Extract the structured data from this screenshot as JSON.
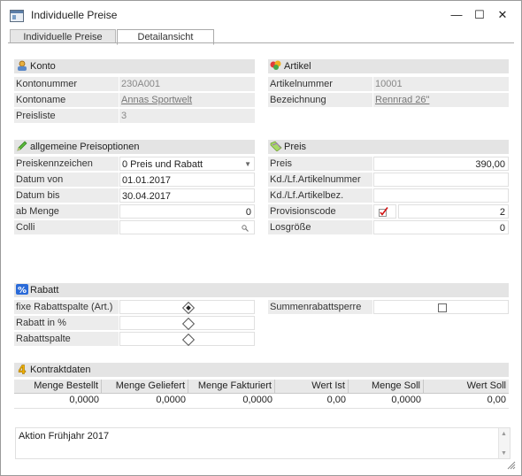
{
  "window": {
    "title": "Individuelle Preise",
    "minimize": "—",
    "maximize": "☐",
    "close": "✕"
  },
  "tabs": [
    {
      "label": "Individuelle Preise"
    },
    {
      "label": "Detailansicht"
    }
  ],
  "konto": {
    "header": "Konto",
    "rows": [
      {
        "label": "Kontonummer",
        "value": "230A001"
      },
      {
        "label": "Kontoname",
        "value": "Annas Sportwelt"
      },
      {
        "label": "Preisliste",
        "value": "3"
      }
    ]
  },
  "artikel": {
    "header": "Artikel",
    "rows": [
      {
        "label": "Artikelnummer",
        "value": "10001"
      },
      {
        "label": "Bezeichnung",
        "value": "Rennrad 26\""
      }
    ]
  },
  "preisoptionen": {
    "header": "allgemeine Preisoptionen",
    "rows": [
      {
        "label": "Preiskennzeichen",
        "value": "0 Preis und Rabatt"
      },
      {
        "label": "Datum von",
        "value": "01.01.2017"
      },
      {
        "label": "Datum bis",
        "value": "30.04.2017"
      },
      {
        "label": "ab Menge",
        "value": "0"
      },
      {
        "label": "Colli",
        "value": ""
      }
    ]
  },
  "preis": {
    "header": "Preis",
    "rows": [
      {
        "label": "Preis",
        "value": "390,00"
      },
      {
        "label": "Kd./Lf.Artikelnummer",
        "value": ""
      },
      {
        "label": "Kd./Lf.Artikelbez.",
        "value": ""
      },
      {
        "label": "Provisionscode",
        "value": "2"
      },
      {
        "label": "Losgröße",
        "value": "0"
      }
    ]
  },
  "rabatt": {
    "header": "Rabatt",
    "rows": [
      {
        "label": "fixe Rabattspalte (Art.)"
      },
      {
        "label": "Rabatt in %"
      },
      {
        "label": "Rabattspalte"
      }
    ],
    "summen_label": "Summenrabattsperre"
  },
  "kontrakt": {
    "header": "Kontraktdaten",
    "columns": [
      "Menge Bestellt",
      "Menge Geliefert",
      "Menge Fakturiert",
      "Wert Ist",
      "Menge Soll",
      "Wert Soll"
    ],
    "values": [
      "0,0000",
      "0,0000",
      "0,0000",
      "0,00",
      "0,0000",
      "0,00"
    ]
  },
  "memo": {
    "text": "Aktion Frühjahr 2017"
  },
  "icons": [
    "konto-icon",
    "artikel-icon",
    "pencil-icon",
    "price-tag-icon",
    "percent-icon",
    "number-four-icon",
    "magnifier-icon",
    "dropdown-arrow-icon",
    "checkmark-icon",
    "resize-grip-icon"
  ],
  "colors": {
    "section_header": "#e4e4e4",
    "label_bg": "#ececec",
    "check_red": "#d01010"
  }
}
